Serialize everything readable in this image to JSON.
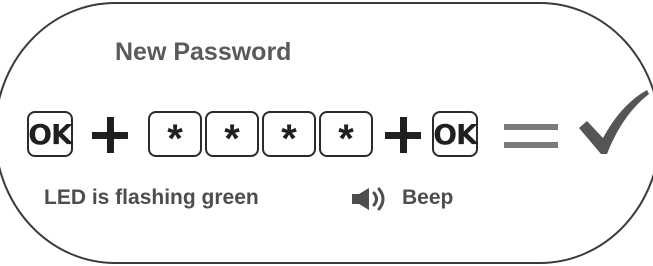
{
  "title": "New Password",
  "sequence": {
    "ok_key_label": "OK",
    "star_key_label": "*",
    "star_count": 4
  },
  "status": {
    "led_text": "LED is flashing green",
    "sound_text": "Beep"
  },
  "icons": {
    "plus": "plus-icon",
    "equals": "equals-icon",
    "result": "checkmark-icon",
    "speaker": "speaker-icon"
  },
  "colors": {
    "frame": "#3a3a3a",
    "text": "#4d4d4d",
    "equals": "#7a7a7a",
    "checkmark": "#555555"
  }
}
